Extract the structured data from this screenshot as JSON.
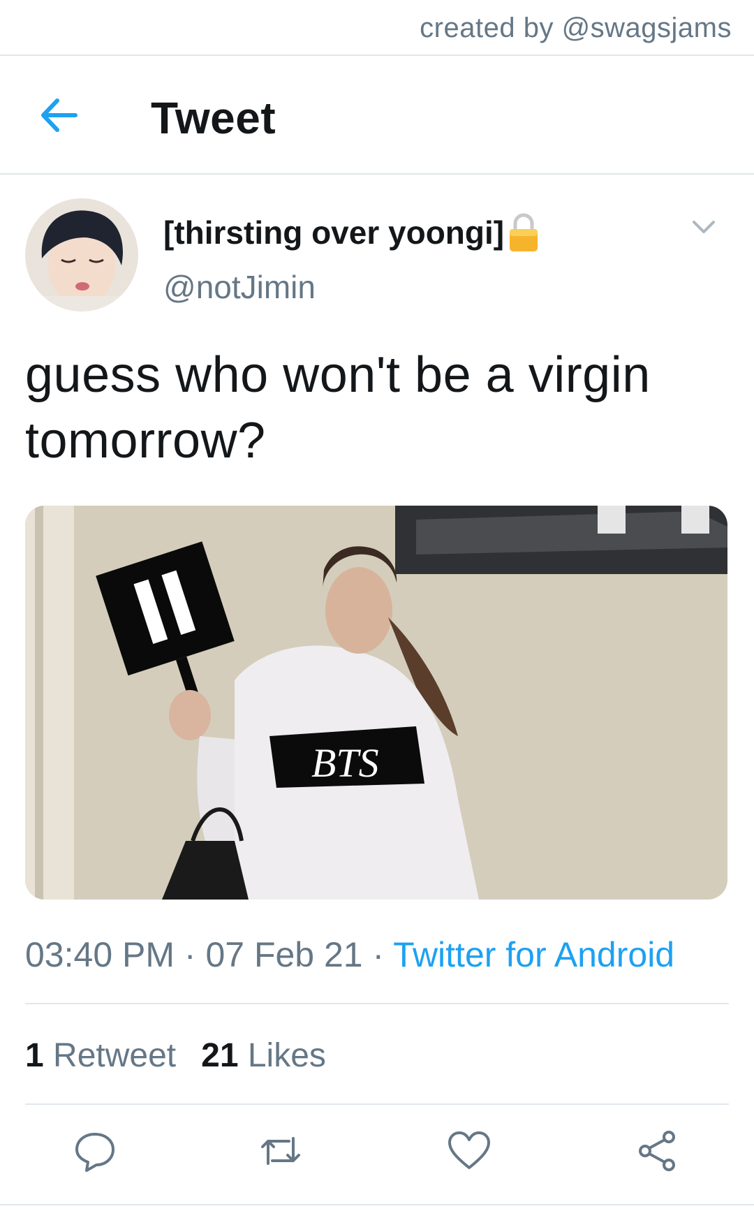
{
  "credit": "created by @swagsjams",
  "header": {
    "title": "Tweet",
    "back_icon": "arrow-left-icon"
  },
  "author": {
    "display_name": "[thirsting over yoongi]",
    "handle": "@notJimin",
    "lock_icon": "lock-icon"
  },
  "tweet": {
    "text": "guess who won't be a virgin tomorrow?",
    "media_caption": "BTS",
    "timestamp": "03:40 PM · 07 Feb 21 · ",
    "source": "Twitter for Android"
  },
  "stats": {
    "retweets_count": "1",
    "retweets_label": " Retweet",
    "likes_count": "21",
    "likes_label": " Likes"
  },
  "actions": [
    "reply-icon",
    "retweet-icon",
    "like-icon",
    "share-icon"
  ],
  "colors": {
    "accent": "#1da1f2",
    "secondary_text": "#657786",
    "divider": "#e1e8ed"
  }
}
